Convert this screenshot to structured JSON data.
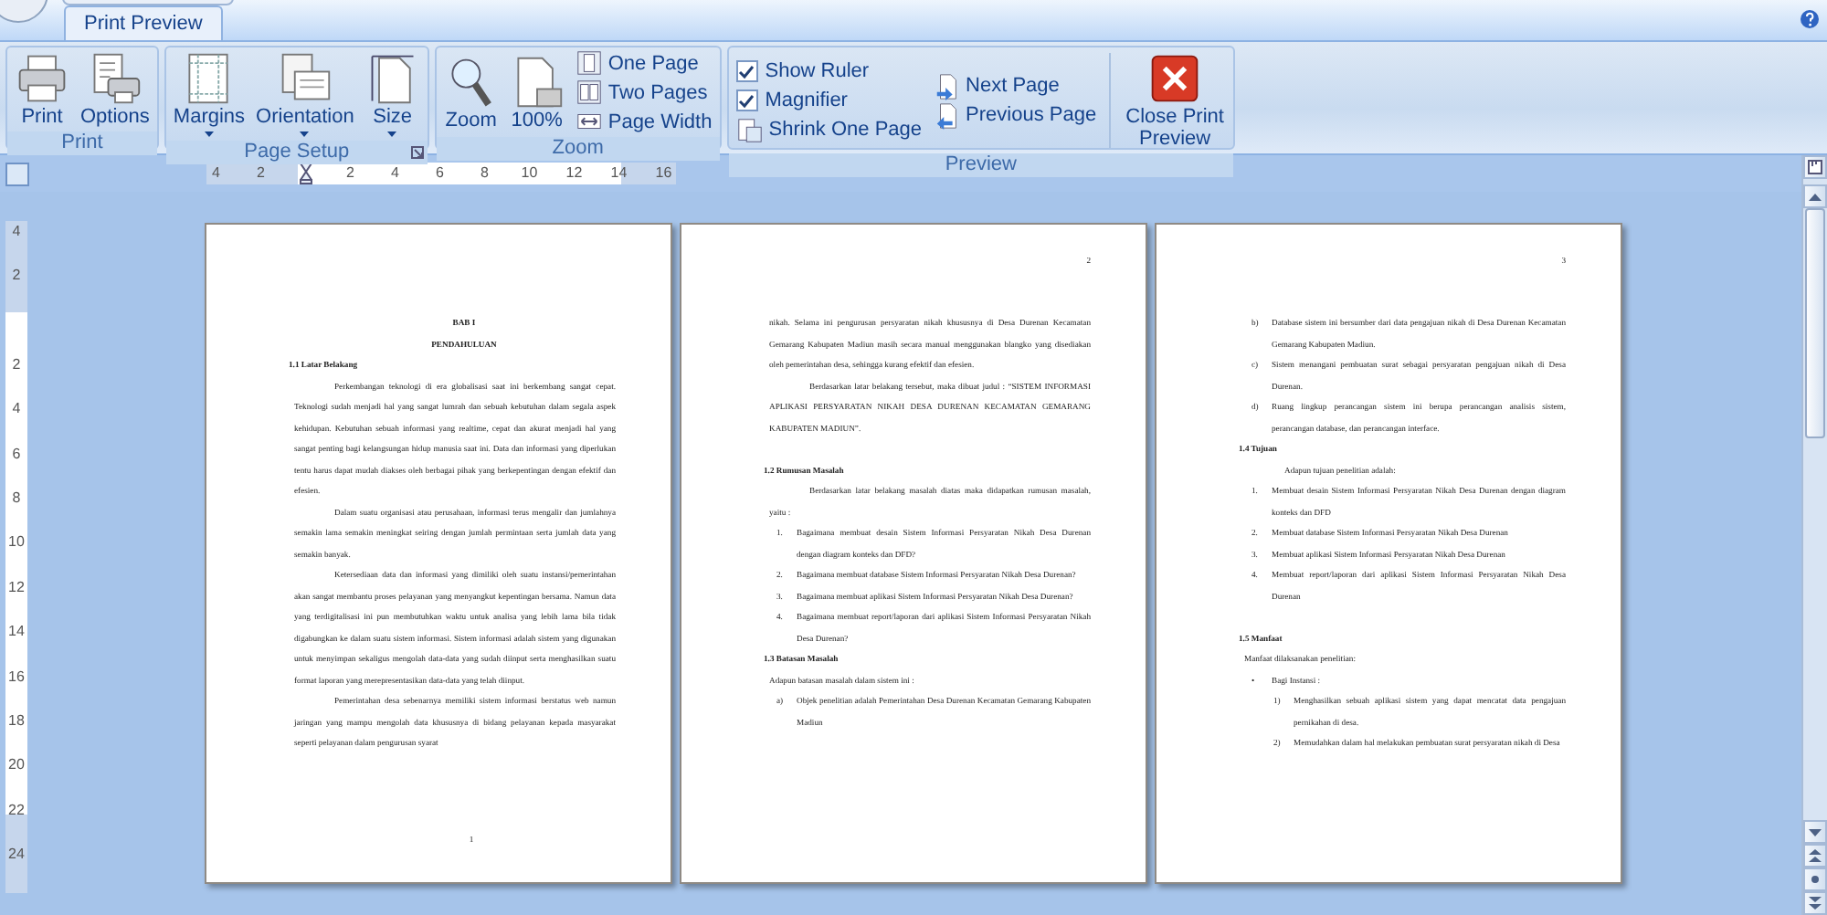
{
  "ribbon": {
    "tabs": [
      {
        "label": "Print Preview",
        "selected": true
      }
    ],
    "groups": [
      {
        "label": "Print",
        "columns": [
          [
            {
              "kind": "large",
              "label": "Print"
            }
          ],
          [
            {
              "kind": "large",
              "label": "Options"
            }
          ]
        ]
      },
      {
        "label": "Page Setup",
        "launcher": true,
        "columns": [
          [
            {
              "kind": "large",
              "label": "Margins",
              "dropdown": true
            }
          ],
          [
            {
              "kind": "large",
              "label": "Orientation",
              "dropdown": true
            }
          ],
          [
            {
              "kind": "large",
              "label": "Size",
              "dropdown": true
            }
          ]
        ]
      },
      {
        "label": "Zoom",
        "columns": [
          [
            {
              "kind": "large",
              "label": "Zoom"
            }
          ],
          [
            {
              "kind": "large",
              "label": "100%"
            }
          ],
          [
            {
              "kind": "small",
              "label": "One Page"
            },
            {
              "kind": "small",
              "label": "Two Pages"
            },
            {
              "kind": "small",
              "label": "Page Width"
            }
          ]
        ]
      },
      {
        "label": "Preview",
        "columns": [
          [
            {
              "kind": "check",
              "label": "Show Ruler",
              "checked": true
            },
            {
              "kind": "check",
              "label": "Magnifier",
              "checked": true
            },
            {
              "kind": "small",
              "label": "Shrink One Page"
            }
          ],
          [
            {
              "kind": "small",
              "label": "Next Page"
            },
            {
              "kind": "small",
              "label": "Previous Page"
            }
          ],
          [
            {
              "kind": "large",
              "label": "Close Print Preview"
            }
          ]
        ]
      }
    ]
  },
  "ruler": {
    "horizontal_labels": [
      "4",
      "2",
      "2",
      "4",
      "6",
      "8",
      "10",
      "12",
      "14",
      "16"
    ],
    "vertical_labels": [
      "4",
      "2",
      "2",
      "4",
      "6",
      "8",
      "10",
      "12",
      "14",
      "16",
      "18",
      "20",
      "22",
      "24"
    ]
  },
  "pages": [
    {
      "footer": "1",
      "blocks": [
        {
          "kind": "title",
          "text": "BAB I"
        },
        {
          "kind": "title",
          "text": "PENDAHULUAN"
        },
        {
          "kind": "heading",
          "text": "1.1 Latar Belakang"
        },
        {
          "kind": "para",
          "text": "Perkembangan teknologi di era globalisasi saat ini berkembang sangat cepat. Teknologi sudah menjadi hal yang sangat lumrah dan sebuah kebutuhan dalam segala aspek kehidupan. Kebutuhan sebuah informasi yang realtime, cepat dan akurat menjadi hal yang sangat penting bagi kelangsungan hidup manusia saat ini. Data dan informasi yang diperlukan tentu harus dapat mudah diakses oleh berbagai pihak yang berkepentingan dengan efektif dan efesien."
        },
        {
          "kind": "para",
          "text": "Dalam suatu organisasi atau perusahaan, informasi terus mengalir dan jumlahnya semakin lama semakin meningkat seiring dengan jumlah permintaan serta jumlah data yang semakin banyak."
        },
        {
          "kind": "para",
          "text": "Ketersediaan data dan informasi yang dimiliki oleh suatu instansi/pemerintahan akan sangat membantu proses pelayanan yang menyangkut kepentingan bersama. Namun data yang terdigitalisasi ini pun membutuhkan waktu untuk analisa yang lebih lama bila tidak digabungkan ke dalam suatu sistem informasi. Sistem informasi adalah sistem yang digunakan untuk menyimpan sekaligus mengolah data-data yang sudah diinput serta menghasilkan suatu format laporan yang merepresentasikan data-data yang telah diinput."
        },
        {
          "kind": "para",
          "text": "Pemerintahan desa sebenarnya memiliki sistem informasi berstatus web namun jaringan yang mampu mengolah data khususnya di bidang pelayanan kepada masyarakat seperti pelayanan dalam pengurusan syarat"
        }
      ]
    },
    {
      "header": "2",
      "blocks": [
        {
          "kind": "plain",
          "text": "nikah. Selama ini pengurusan persyaratan nikah khususnya di Desa Durenan Kecamatan Gemarang Kabupaten Madiun masih secara manual menggunakan blangko yang disediakan oleh pemerintahan desa, sehingga kurang efektif dan efesien."
        },
        {
          "kind": "para",
          "text": "Berdasarkan latar belakang tersebut, maka dibuat judul : “SISTEM INFORMASI APLIKASI PERSYARATAN NIKAH DESA DURENAN KECAMATAN GEMARANG KABUPATEN MADIUN”."
        },
        {
          "kind": "heading",
          "text": "1.2 Rumusan Masalah",
          "gap_before": true
        },
        {
          "kind": "para",
          "text": "Berdasarkan latar belakang masalah diatas maka didapatkan rumusan masalah, yaitu :"
        },
        {
          "kind": "item",
          "marker": "1.",
          "text": "Bagaimana membuat desain Sistem Informasi Persyaratan Nikah Desa Durenan dengan diagram konteks dan DFD?"
        },
        {
          "kind": "item",
          "marker": "2.",
          "text": "Bagaimana membuat database Sistem Informasi Persyaratan Nikah Desa Durenan?"
        },
        {
          "kind": "item",
          "marker": "3.",
          "text": "Bagaimana membuat aplikasi Sistem Informasi Persyaratan Nikah Desa Durenan?"
        },
        {
          "kind": "item",
          "marker": "4.",
          "text": "Bagaimana membuat report/laporan dari aplikasi Sistem Informasi Persyaratan Nikah Desa Durenan?"
        },
        {
          "kind": "heading",
          "text": "1.3 Batasan Masalah"
        },
        {
          "kind": "plain",
          "text": "Adapun batasan masalah dalam sistem ini :"
        },
        {
          "kind": "item",
          "marker": "a)",
          "text": "Objek penelitian adalah Pemerintahan Desa Durenan Kecamatan Gemarang Kabupaten Madiun"
        }
      ]
    },
    {
      "header": "3",
      "blocks": [
        {
          "kind": "item",
          "marker": "b)",
          "text": "Database sistem ini bersumber dari data pengajuan nikah di Desa Durenan Kecamatan Gemarang Kabupaten Madiun."
        },
        {
          "kind": "item",
          "marker": "c)",
          "text": "Sistem menangani pembuatan surat sebagai persyaratan pengajuan nikah di Desa Durenan."
        },
        {
          "kind": "item",
          "marker": "d)",
          "text": "Ruang lingkup perancangan sistem ini berupa perancangan analisis sistem, perancangan database, dan perancangan interface."
        },
        {
          "kind": "heading",
          "text": "1.4 Tujuan"
        },
        {
          "kind": "para",
          "text": "Adapun tujuan penelitian adalah:"
        },
        {
          "kind": "item",
          "marker": "1.",
          "text": "Membuat desain Sistem Informasi Persyaratan Nikah Desa Durenan dengan diagram konteks dan DFD"
        },
        {
          "kind": "item",
          "marker": "2.",
          "text": "Membuat database Sistem Informasi Persyaratan Nikah Desa Durenan"
        },
        {
          "kind": "item",
          "marker": "3.",
          "text": "Membuat aplikasi Sistem Informasi Persyaratan Nikah Desa Durenan"
        },
        {
          "kind": "item",
          "marker": "4.",
          "text": "Membuat report/laporan dari aplikasi Sistem Informasi Persyaratan Nikah Desa Durenan"
        },
        {
          "kind": "heading",
          "text": "1.5 Manfaat",
          "gap_before": true
        },
        {
          "kind": "plain",
          "text": "Manfaat dilaksanakan penelitian:"
        },
        {
          "kind": "item",
          "marker": "•",
          "text": "Bagi Instansi :",
          "children": [
            {
              "kind": "item",
              "marker": "1)",
              "text": "Menghasilkan sebuah aplikasi sistem yang dapat mencatat data pengajuan pernikahan di desa."
            },
            {
              "kind": "item",
              "marker": "2)",
              "text": "Memudahkan dalam hal melakukan pembuatan surat persyaratan nikah di Desa"
            }
          ]
        }
      ]
    }
  ]
}
